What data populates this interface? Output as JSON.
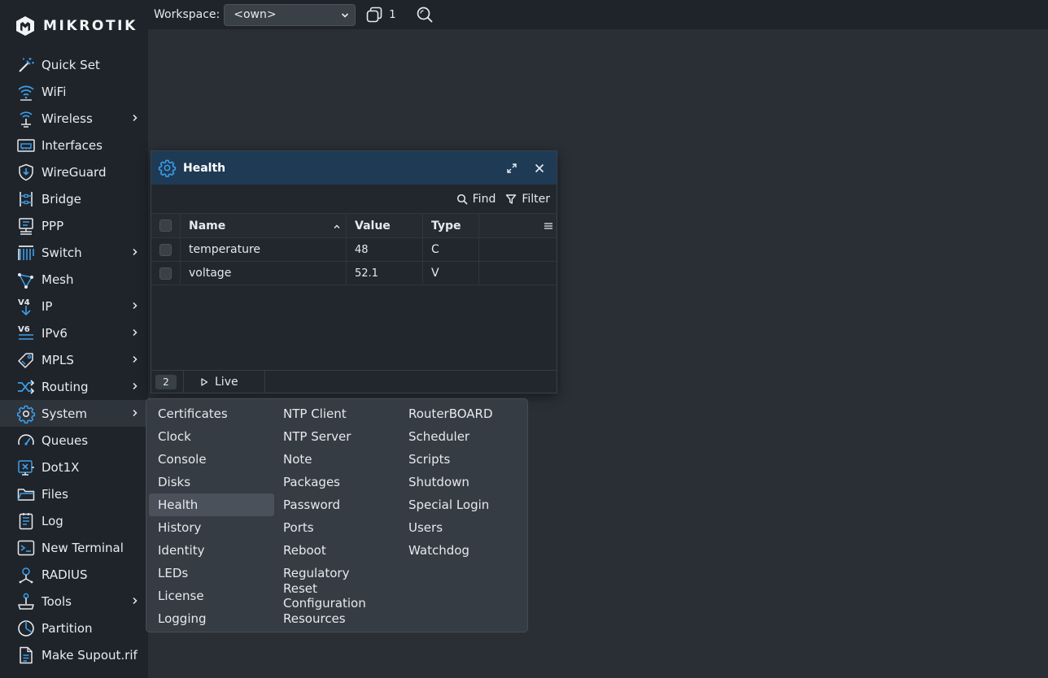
{
  "brand": {
    "name": "MIKROTIK"
  },
  "sidebar": {
    "items": [
      {
        "label": "Quick Set",
        "icon": "magic-wand-icon",
        "has_submenu": false
      },
      {
        "label": "WiFi",
        "icon": "wifi-icon",
        "has_submenu": false
      },
      {
        "label": "Wireless",
        "icon": "wireless-icon",
        "has_submenu": true
      },
      {
        "label": "Interfaces",
        "icon": "interfaces-icon",
        "has_submenu": false
      },
      {
        "label": "WireGuard",
        "icon": "wireguard-shield-icon",
        "has_submenu": false
      },
      {
        "label": "Bridge",
        "icon": "bridge-icon",
        "has_submenu": false
      },
      {
        "label": "PPP",
        "icon": "ppp-icon",
        "has_submenu": false
      },
      {
        "label": "Switch",
        "icon": "switch-icon",
        "has_submenu": true
      },
      {
        "label": "Mesh",
        "icon": "mesh-icon",
        "has_submenu": false
      },
      {
        "label": "IP",
        "icon": "ipv4-icon",
        "has_submenu": true
      },
      {
        "label": "IPv6",
        "icon": "ipv6-icon",
        "has_submenu": true
      },
      {
        "label": "MPLS",
        "icon": "mpls-tag-icon",
        "has_submenu": true
      },
      {
        "label": "Routing",
        "icon": "routing-shuffle-icon",
        "has_submenu": true
      },
      {
        "label": "System",
        "icon": "gear-icon",
        "has_submenu": true,
        "active": true
      },
      {
        "label": "Queues",
        "icon": "gauge-icon",
        "has_submenu": false
      },
      {
        "label": "Dot1X",
        "icon": "dot1x-icon",
        "has_submenu": false
      },
      {
        "label": "Files",
        "icon": "folder-icon",
        "has_submenu": false
      },
      {
        "label": "Log",
        "icon": "log-icon",
        "has_submenu": false
      },
      {
        "label": "New Terminal",
        "icon": "terminal-icon",
        "has_submenu": false
      },
      {
        "label": "RADIUS",
        "icon": "radius-icon",
        "has_submenu": false
      },
      {
        "label": "Tools",
        "icon": "joystick-icon",
        "has_submenu": true
      },
      {
        "label": "Partition",
        "icon": "partition-pie-icon",
        "has_submenu": false
      },
      {
        "label": "Make Supout.rif",
        "icon": "supout-file-icon",
        "has_submenu": false
      }
    ]
  },
  "topbar": {
    "workspace_label": "Workspace:",
    "workspace_value": "<own>",
    "window_count": "1"
  },
  "health_window": {
    "title": "Health",
    "find_label": "Find",
    "filter_label": "Filter",
    "columns": {
      "name": "Name",
      "value": "Value",
      "type": "Type"
    },
    "rows": [
      {
        "name": "temperature",
        "value": "48",
        "type": "C"
      },
      {
        "name": "voltage",
        "value": "52.1",
        "type": "V"
      }
    ],
    "count": "2",
    "live_label": "Live"
  },
  "system_submenu": {
    "columns": [
      [
        "Certificates",
        "Clock",
        "Console",
        "Disks",
        "Health",
        "History",
        "Identity",
        "LEDs",
        "License",
        "Logging"
      ],
      [
        "NTP Client",
        "NTP Server",
        "Note",
        "Packages",
        "Password",
        "Ports",
        "Reboot",
        "Regulatory",
        "Reset Configuration",
        "Resources"
      ],
      [
        "RouterBOARD",
        "Scheduler",
        "Scripts",
        "Shutdown",
        "Special Login",
        "Users",
        "Watchdog"
      ]
    ],
    "highlighted": "Health"
  },
  "colors": {
    "accent": "#3d9ee8",
    "sidebar_bg": "#1f242a",
    "desktop_bg": "#2a2f36",
    "window_title_bg": "#1e3a55"
  }
}
